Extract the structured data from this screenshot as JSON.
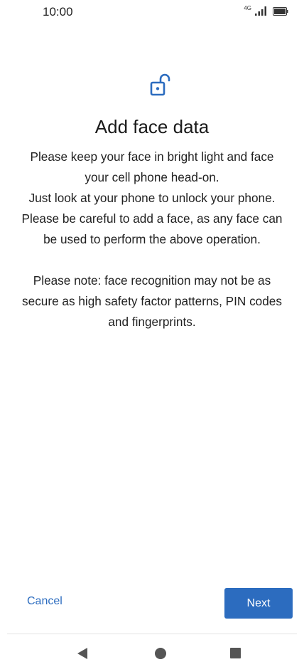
{
  "status_bar": {
    "time": "10:00",
    "network": "4G",
    "icons": [
      "signal-icon",
      "battery-icon"
    ]
  },
  "header": {
    "icon": "unlock-icon",
    "title": "Add face data"
  },
  "body": {
    "paragraph_1": "Please keep your face in bright light and face your cell phone head-on.",
    "paragraph_2": "Just look at your phone to unlock your phone. Please be careful to add a face, as any face can be used to perform the above operation.",
    "note": "Please note: face recognition may not be as secure as high safety factor patterns, PIN codes and fingerprints."
  },
  "actions": {
    "cancel_label": "Cancel",
    "next_label": "Next"
  },
  "nav_bar": {
    "icons": [
      "back-icon",
      "home-icon",
      "recents-icon"
    ]
  },
  "colors": {
    "accent": "#2c6cbf",
    "text": "#1a1a1a",
    "background": "#ffffff"
  }
}
